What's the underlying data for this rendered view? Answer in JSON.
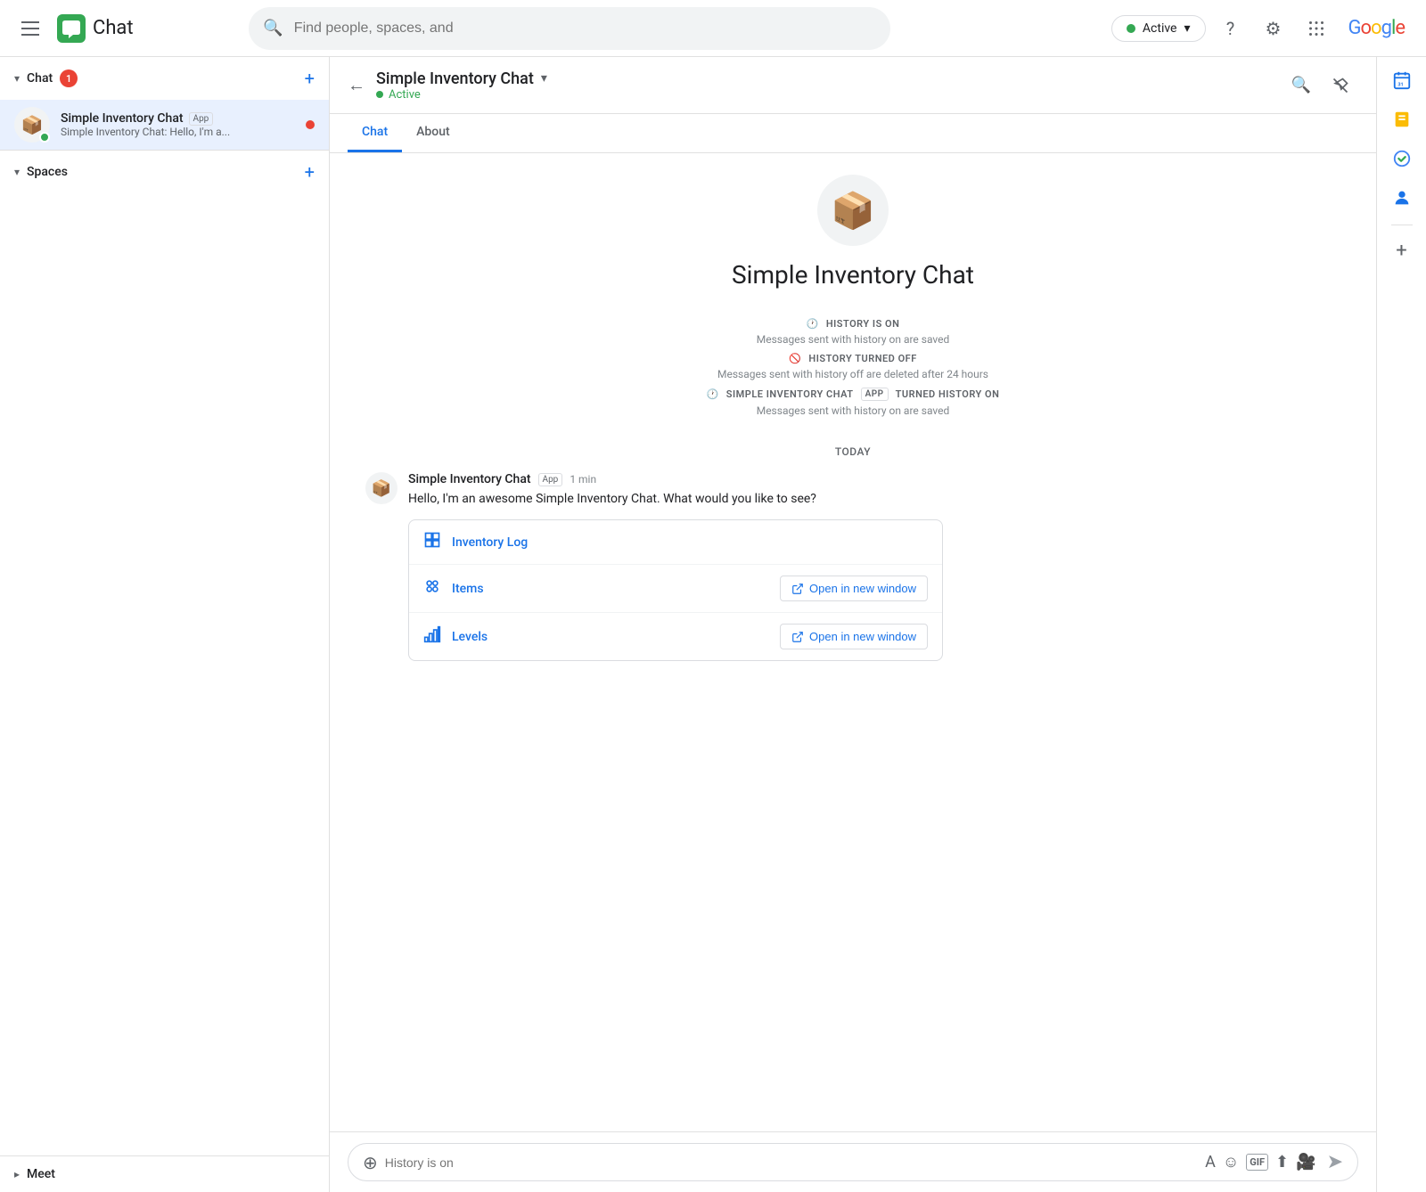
{
  "topnav": {
    "app_title": "Chat",
    "search_placeholder": "Find people, spaces, and",
    "status_label": "Active",
    "google_label": "Google"
  },
  "sidebar": {
    "chat_section_label": "Chat",
    "chat_badge": "1",
    "spaces_section_label": "Spaces",
    "meet_section_label": "Meet",
    "add_label": "+",
    "chat_item": {
      "name": "Simple Inventory Chat",
      "app_badge": "App",
      "preview": "Simple Inventory Chat: Hello, I'm a..."
    }
  },
  "chat": {
    "back_label": "←",
    "header_name": "Simple Inventory Chat",
    "header_status": "Active",
    "tab_chat": "Chat",
    "tab_about": "About",
    "bot_name": "Simple Inventory Chat",
    "history_on_title": "HISTORY IS ON",
    "history_on_sub": "Messages sent with history on are saved",
    "history_off_title": "HISTORY TURNED OFF",
    "history_off_sub": "Messages sent with history off are deleted after 24 hours",
    "history_on2_title": "SIMPLE INVENTORY CHAT",
    "history_on2_app": "APP",
    "history_on2_rest": "TURNED HISTORY ON",
    "history_on2_sub": "Messages sent with history on are saved",
    "today_label": "TODAY",
    "message": {
      "sender": "Simple Inventory Chat",
      "app_badge": "App",
      "time": "1 min",
      "text": "Hello, I'm an awesome  Simple Inventory Chat. What would you like to see?"
    },
    "card": {
      "rows": [
        {
          "icon": "📊",
          "label": "Inventory Log",
          "has_open_btn": false
        },
        {
          "icon": "🔷",
          "label": "Items",
          "has_open_btn": true,
          "open_label": "Open in new window"
        },
        {
          "icon": "📈",
          "label": "Levels",
          "has_open_btn": true,
          "open_label": "Open in new window"
        }
      ]
    },
    "input_placeholder": "History is on"
  },
  "right_sidebar": {
    "items": [
      {
        "icon": "📅",
        "color": "#1a73e8",
        "badge": null
      },
      {
        "icon": "💡",
        "color": "#fbbc05",
        "badge": null
      },
      {
        "icon": "✅",
        "color": "#34a853",
        "badge": null
      },
      {
        "icon": "👤",
        "color": "#1a73e8",
        "badge": null
      }
    ]
  }
}
